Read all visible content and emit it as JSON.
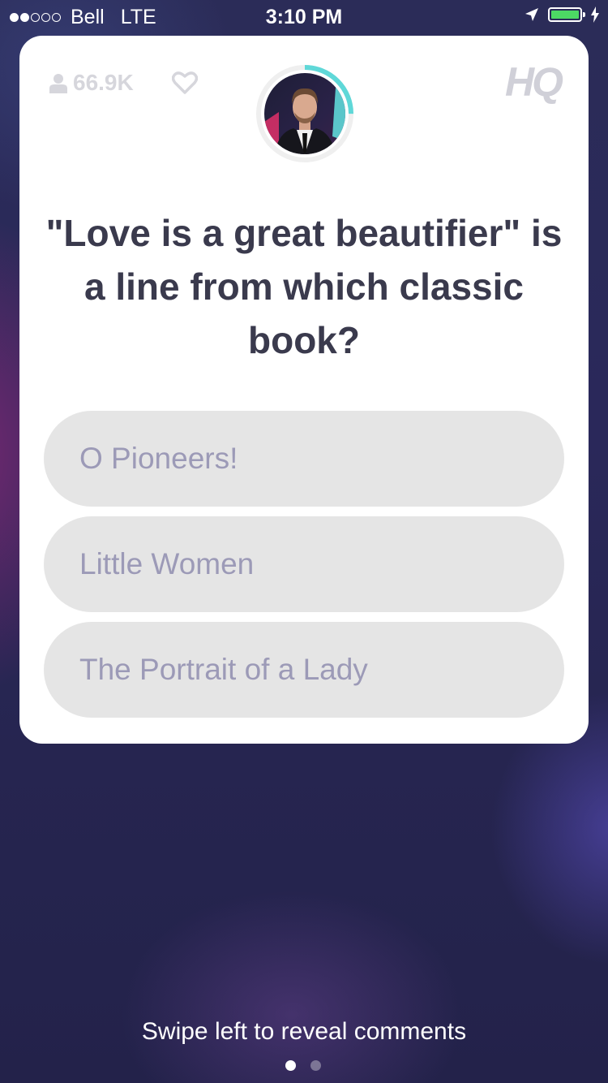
{
  "status_bar": {
    "carrier": "Bell",
    "network": "LTE",
    "time": "3:10 PM"
  },
  "game": {
    "viewer_count": "66.9K",
    "logo": "HQ",
    "timer_progress": 0.25,
    "question": "\"Love is a great beautifier\" is a line from which classic book?",
    "answers": [
      "O Pioneers!",
      "Little Women",
      "The Portrait of a Lady"
    ]
  },
  "footer": {
    "hint": "Swipe left to reveal comments",
    "page_index": 0,
    "page_count": 2
  },
  "colors": {
    "accent_timer": "#5fd8d8",
    "answer_bg": "#e5e5e5",
    "answer_text": "#9c9ab7",
    "question_text": "#3a3a4d"
  },
  "icons": [
    "signal-dots-icon",
    "location-arrow-icon",
    "battery-icon",
    "charging-bolt-icon",
    "user-icon",
    "heart-icon"
  ]
}
